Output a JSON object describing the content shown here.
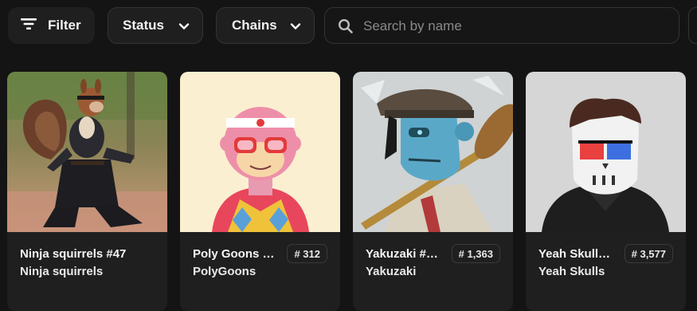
{
  "toolbar": {
    "filter_label": "Filter",
    "status_label": "Status",
    "chains_label": "Chains",
    "search_placeholder": "Search by name"
  },
  "cards": [
    {
      "name": "Ninja squirrels #47",
      "collection": "Ninja squirrels",
      "rank": ""
    },
    {
      "name": "Poly Goons #1…",
      "collection": "PolyGoons",
      "rank": "# 312"
    },
    {
      "name": "Yakuzaki #1…",
      "collection": "Yakuzaki",
      "rank": "# 1,363"
    },
    {
      "name": "Yeah Skulls …",
      "collection": "Yeah Skulls",
      "rank": "# 3,577"
    }
  ]
}
